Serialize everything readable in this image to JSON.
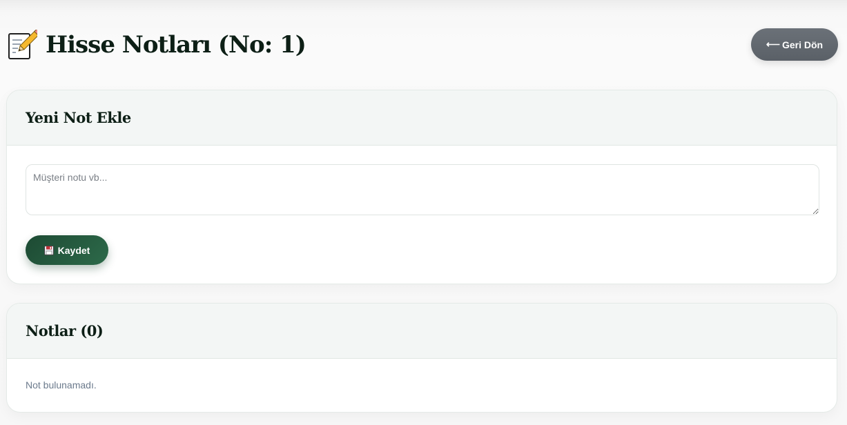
{
  "header": {
    "title": "Hisse Notları (No: 1)",
    "title_icon": "memo-icon",
    "back_button": {
      "label": "Geri Dön",
      "icon": "left-arrow-icon",
      "arrow_glyph": "⟵"
    }
  },
  "new_note_card": {
    "title": "Yeni Not Ekle",
    "textarea": {
      "placeholder": "Müşteri notu vb...",
      "value": ""
    },
    "save_button": {
      "label": "Kaydet",
      "icon": "floppy-disk-icon"
    }
  },
  "notes_card": {
    "title": "Notlar (0)",
    "empty_message": "Not bulunamadı."
  },
  "colors": {
    "primary_green": "#1d4a33",
    "back_button_gray": "#62686f",
    "heading_text": "#0d1f16",
    "muted_text": "#6b7a8c"
  }
}
